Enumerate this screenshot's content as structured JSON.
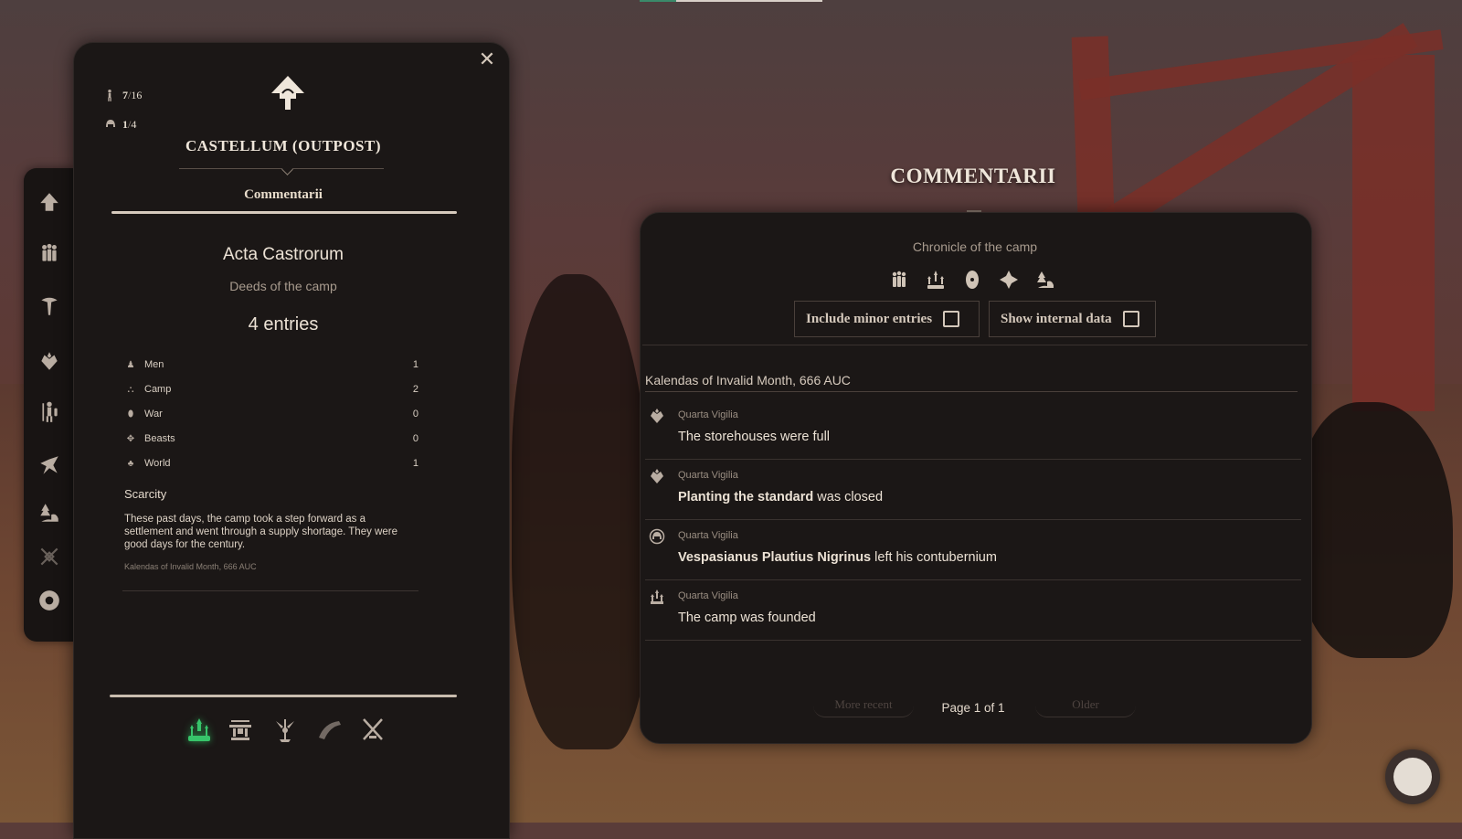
{
  "camp": {
    "title": "CASTELLUM (OUTPOST)",
    "men_current": "7",
    "men_max": "16",
    "slots_current": "1",
    "slots_max": "4",
    "tab": "Commentarii"
  },
  "acta": {
    "title": "Acta Castrorum",
    "subtitle": "Deeds of the camp",
    "count": "4 entries",
    "categories": [
      {
        "name": "Men",
        "value": "1",
        "icon": "men-icon"
      },
      {
        "name": "Camp",
        "value": "2",
        "icon": "camp-icon"
      },
      {
        "name": "War",
        "value": "0",
        "icon": "shield-icon"
      },
      {
        "name": "Beasts",
        "value": "0",
        "icon": "beasts-icon"
      },
      {
        "name": "World",
        "value": "1",
        "icon": "world-icon"
      }
    ],
    "scarcity_title": "Scarcity",
    "scarcity_text": "These past days, the camp took a step forward as a settlement and went through a supply shortage. They were good days for the century.",
    "scarcity_date": "Kalendas of Invalid Month, 666 AUC"
  },
  "commentarii": {
    "heading": "COMMENTARII",
    "chronicle": "Chronicle of the camp",
    "include_minor": "Include minor entries",
    "show_internal": "Show internal data",
    "date_header": "Kalendas of Invalid Month, 666 AUC",
    "entries": [
      {
        "time": "Quarta Vigilia",
        "bold": "",
        "text": "The storehouses were full",
        "icon": "harvest-icon"
      },
      {
        "time": "Quarta Vigilia",
        "bold": "Planting the standard",
        "text": " was closed",
        "icon": "harvest-icon"
      },
      {
        "time": "Quarta Vigilia",
        "bold": "Vespasianus Plautius Nigrinus",
        "text": " left his contubernium",
        "icon": "helmet-icon"
      },
      {
        "time": "Quarta Vigilia",
        "bold": "",
        "text": "The camp was founded",
        "icon": "camp-icon"
      }
    ],
    "more_recent": "More recent",
    "older": "Older",
    "page_label": "Page 1 of 1"
  },
  "colors": {
    "accent_active": "#37c46a",
    "panel_bg": "#1b1716",
    "text": "#ece2d5"
  }
}
